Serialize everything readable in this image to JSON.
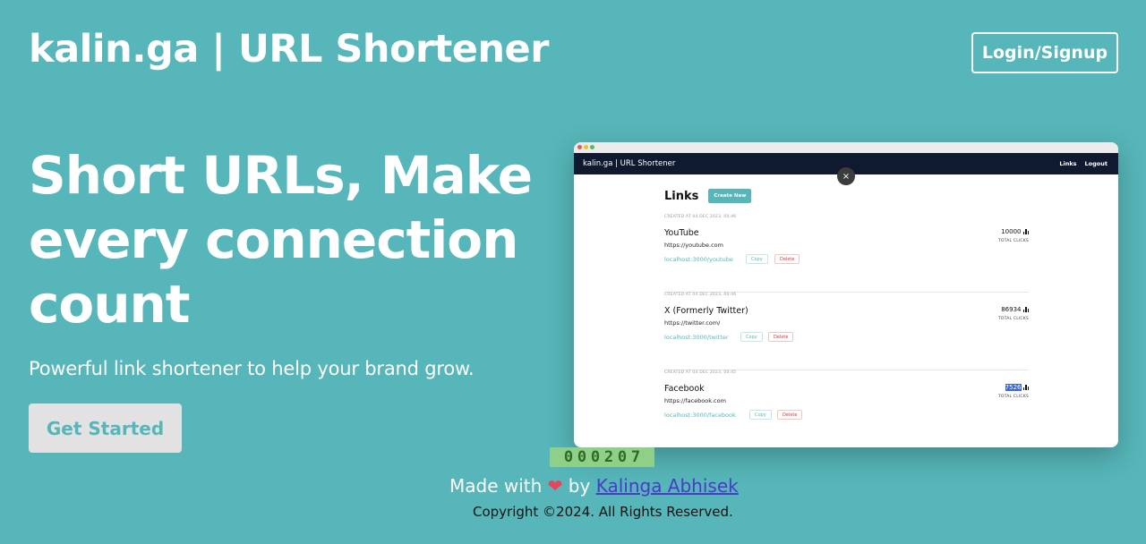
{
  "header": {
    "brand": "kalin.ga | URL Shortener",
    "login_label": "Login/Signup"
  },
  "hero": {
    "headline": "Short URLs, Make every connection count",
    "subheadline": "Powerful link shortener to help your brand grow.",
    "cta_label": "Get Started"
  },
  "preview": {
    "brand": "kalin.ga | URL Shortener",
    "nav_links": [
      "Links",
      "Logout"
    ],
    "close_glyph": "×",
    "title": "Links",
    "create_label": "Create New",
    "links": [
      {
        "date": "CREATED AT 04 DEC 2023, 00:46",
        "name": "YouTube",
        "url": "https://youtube.com",
        "short": "localhost:3000/youtube",
        "copy": "Copy",
        "delete": "Delete",
        "clicks": "10000",
        "clicks_label": "TOTAL CLICKS"
      },
      {
        "date": "CREATED AT 04 DEC 2023, 00:46",
        "name": "X (Formerly Twitter)",
        "url": "https://twitter.com/",
        "short": "localhost:3000/twitter",
        "copy": "Copy",
        "delete": "Delete",
        "clicks": "86934",
        "clicks_label": "TOTAL CLICKS"
      },
      {
        "date": "CREATED AT 04 DEC 2023, 00:45",
        "name": "Facebook",
        "url": "https://facebook.com",
        "short": "localhost:3000/facebook",
        "copy": "Copy",
        "delete": "Delete",
        "clicks": "7526",
        "clicks_label": "TOTAL CLICKS"
      }
    ]
  },
  "counter": {
    "digits": [
      "0",
      "0",
      "0",
      "2",
      "0",
      "7"
    ]
  },
  "footer": {
    "made_with": "Made with",
    "by": "by",
    "author": "Kalinga Abhisek",
    "heart_icon": "heart-icon",
    "copyright": "Copyright ©2024. All Rights Reserved."
  },
  "colors": {
    "background": "#56b6b9",
    "accent": "#56b6b9",
    "nav_dark": "#0f1a30",
    "cta_bg": "#e2e2e2"
  }
}
